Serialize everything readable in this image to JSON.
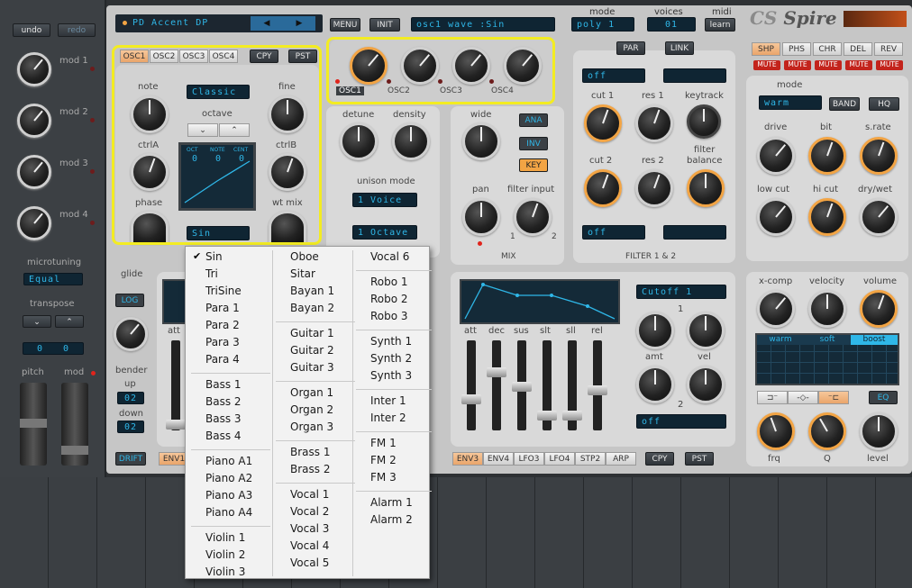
{
  "top": {
    "preset_name": "PD Accent DP",
    "menu_btn": "MENU",
    "init_btn": "INIT",
    "param_display": "osc1 wave   :Sin",
    "mode_label": "mode",
    "mode_value": "poly 1",
    "voices_label": "voices",
    "voices_value": "01",
    "midi_label": "midi",
    "learn_btn": "learn",
    "logo": "Spire"
  },
  "left": {
    "undo": "undo",
    "redo": "redo",
    "mods": [
      "mod 1",
      "mod 2",
      "mod 3",
      "mod 4"
    ],
    "microtuning_label": "microtuning",
    "microtuning_value": "Equal",
    "transpose_label": "transpose",
    "transpose_values": [
      "0",
      "0"
    ],
    "pitch_label": "pitch",
    "mod_label": "mod"
  },
  "osc": {
    "tabs": [
      "OSC1",
      "OSC2",
      "OSC3",
      "OSC4"
    ],
    "cpy": "CPY",
    "pst": "PST",
    "note": "note",
    "fine": "fine",
    "octave": "octave",
    "ctrlA": "ctrlA",
    "ctrlB": "ctrlB",
    "phase": "phase",
    "wtmix": "wt mix",
    "mode_value": "Classic",
    "wave_value": "Sin",
    "display_labels": [
      "OCT",
      "NOTE",
      "CENT"
    ],
    "display_values": [
      "0",
      "0",
      "0"
    ],
    "mix_labels": [
      "OSC1",
      "OSC2",
      "OSC3",
      "OSC4"
    ]
  },
  "unison": {
    "detune": "detune",
    "density": "density",
    "mode_label": "unison mode",
    "voice_value": "1 Voice",
    "octave_value": "1 Octave"
  },
  "mixsec": {
    "wide": "wide",
    "pan": "pan",
    "filter_input": "filter input",
    "one": "1",
    "two": "2",
    "title": "MIX",
    "ana": "ANA",
    "inv": "INV",
    "key": "KEY"
  },
  "filter": {
    "par": "PAR",
    "link": "LINK",
    "off1": "off",
    "off2": "off",
    "cut1": "cut 1",
    "res1": "res 1",
    "keytrack": "keytrack",
    "cut2": "cut 2",
    "res2": "res 2",
    "balance": "filter\nbalance",
    "title": "FILTER 1 & 2"
  },
  "fx": {
    "tabs": [
      "SHP",
      "PHS",
      "CHR",
      "DEL",
      "REV"
    ],
    "mute": "MUTE",
    "mode": "mode",
    "mode_value": "warm",
    "band": "BAND",
    "hq": "HQ",
    "drive": "drive",
    "bit": "bit",
    "srate": "s.rate",
    "lowcut": "low cut",
    "hicut": "hi cut",
    "drywet": "dry/wet"
  },
  "eq": {
    "xcomp": "x-comp",
    "velocity": "velocity",
    "volume": "volume",
    "tabs": [
      "warm",
      "soft",
      "boost"
    ],
    "eq_btn": "EQ",
    "frq": "frq",
    "q": "Q",
    "level": "level"
  },
  "env": {
    "labels": [
      "att",
      "dec",
      "sus",
      "slt",
      "sll",
      "rel"
    ],
    "cutoff_value": "Cutoff  1",
    "amt": "amt",
    "vel": "vel",
    "one": "1",
    "two": "2",
    "off": "off",
    "tabs": [
      "ENV3",
      "ENV4",
      "LFO3",
      "LFO4",
      "STP2",
      "ARP"
    ],
    "cpy": "CPY",
    "pst": "PST"
  },
  "misc": {
    "glide": "glide",
    "log": "LOG",
    "bender": "bender",
    "up": "up",
    "up_val": "02",
    "down": "down",
    "down_val": "02",
    "drift": "DRIFT",
    "env1": "ENV1",
    "att": "att"
  },
  "menu": {
    "checked": "Sin",
    "col1": [
      [
        "Sin",
        "Tri",
        "TriSine",
        "Para 1",
        "Para 2",
        "Para 3",
        "Para 4"
      ],
      [
        "Bass 1",
        "Bass 2",
        "Bass 3",
        "Bass 4"
      ],
      [
        "Piano A1",
        "Piano A2",
        "Piano A3",
        "Piano A4"
      ],
      [
        "Violin 1",
        "Violin 2",
        "Violin 3"
      ]
    ],
    "col2": [
      [
        "Oboe",
        "Sitar",
        "Bayan 1",
        "Bayan 2"
      ],
      [
        "Guitar 1",
        "Guitar 2",
        "Guitar 3"
      ],
      [
        "Organ 1",
        "Organ 2",
        "Organ 3"
      ],
      [
        "Brass 1",
        "Brass 2"
      ],
      [
        "Vocal 1",
        "Vocal 2",
        "Vocal 3",
        "Vocal 4",
        "Vocal 5"
      ]
    ],
    "col3": [
      [
        "Vocal 6"
      ],
      [
        "Robo 1",
        "Robo 2",
        "Robo 3"
      ],
      [
        "Synth 1",
        "Synth 2",
        "Synth 3"
      ],
      [
        "Inter 1",
        "Inter 2"
      ],
      [
        "FM 1",
        "FM 2",
        "FM 3"
      ],
      [
        "Alarm 1",
        "Alarm 2"
      ]
    ]
  },
  "colors": {
    "accent": "#f2a444",
    "lcd_text": "#2fb7e8",
    "highlight": "#f3ec22",
    "mute": "#c3241c"
  }
}
